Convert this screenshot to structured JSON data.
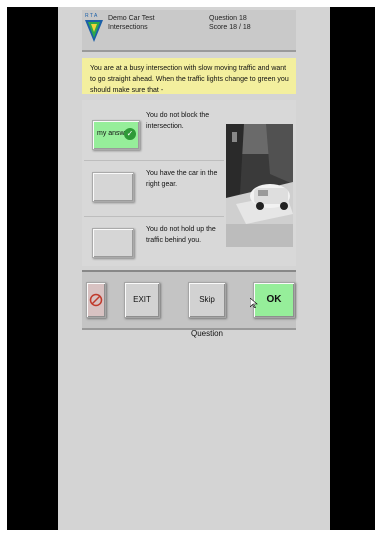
{
  "header": {
    "logo_text": "R T A",
    "app_title": "Demo Car Test",
    "section": "Intersections",
    "question_label": "Question 18",
    "score_label": "Score 18 / 18"
  },
  "question": {
    "text": "You are at a busy intersection with slow moving traffic and want to go straight ahead. When the traffic lights change to green you should make sure that -"
  },
  "answers": [
    {
      "text": "You do not block the intersection.",
      "selected": true,
      "selected_label": "my answer"
    },
    {
      "text": "You have the car in the right gear.",
      "selected": false
    },
    {
      "text": "You do not hold up the traffic behind you.",
      "selected": false
    }
  ],
  "toolbar": {
    "exit_label": "EXIT",
    "skip_label": "Skip Question",
    "ok_label": "OK"
  },
  "colors": {
    "question_banner": "#f3ef9e",
    "selected_green": "#96ee9a",
    "header_gray": "#c9c9c9",
    "screen_gray": "#d4d4d4"
  },
  "icons": {
    "no_entry": "no-entry-icon",
    "check": "check-icon",
    "cursor": "mouse-cursor-icon",
    "logo": "rta-logo-icon"
  }
}
